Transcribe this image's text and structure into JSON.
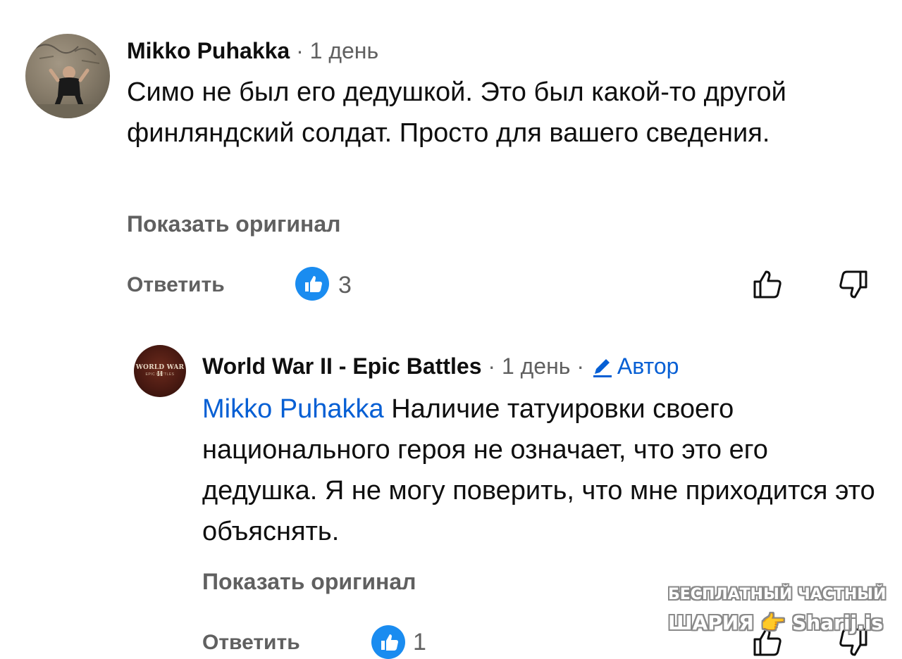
{
  "comments": [
    {
      "author": "Mikko Puhakka",
      "separator": "·",
      "time": "1 день",
      "text": "Симо не был его дедушкой. Это был какой-то другой финляндский солдат. Просто для вашего сведения.",
      "show_original": "Показать оригинал",
      "reply_label": "Ответить",
      "like_count": "3",
      "avatar": "user-photo-avatar"
    },
    {
      "author": "World War II - Epic Battles",
      "separator": "·",
      "time": "1 день",
      "separator2": "·",
      "author_badge": "Автор",
      "mention": "Mikko Puhakka",
      "text": "Наличие татуировки своего национального героя не означает, что это его дедушка. Я не могу поверить, что мне приходится это объяснять.",
      "show_original": "Показать оригинал",
      "reply_label": "Ответить",
      "like_count": "1",
      "avatar_title": "WORLD WAR II",
      "avatar_subtitle": "EPIC BATTLES"
    }
  ],
  "watermark": {
    "line1": "БЕСПЛАТНЫЙ ЧАСТНЫЙ",
    "line2": "ШАРИЯ 👉 Sharij.is"
  },
  "colors": {
    "text": "#0f0f0f",
    "secondary": "#606060",
    "link": "#065fd4",
    "like_badge": "#1a8cf0"
  },
  "icons": [
    "pencil-icon",
    "thumbs-up-badge-icon",
    "like-icon",
    "dislike-icon"
  ]
}
